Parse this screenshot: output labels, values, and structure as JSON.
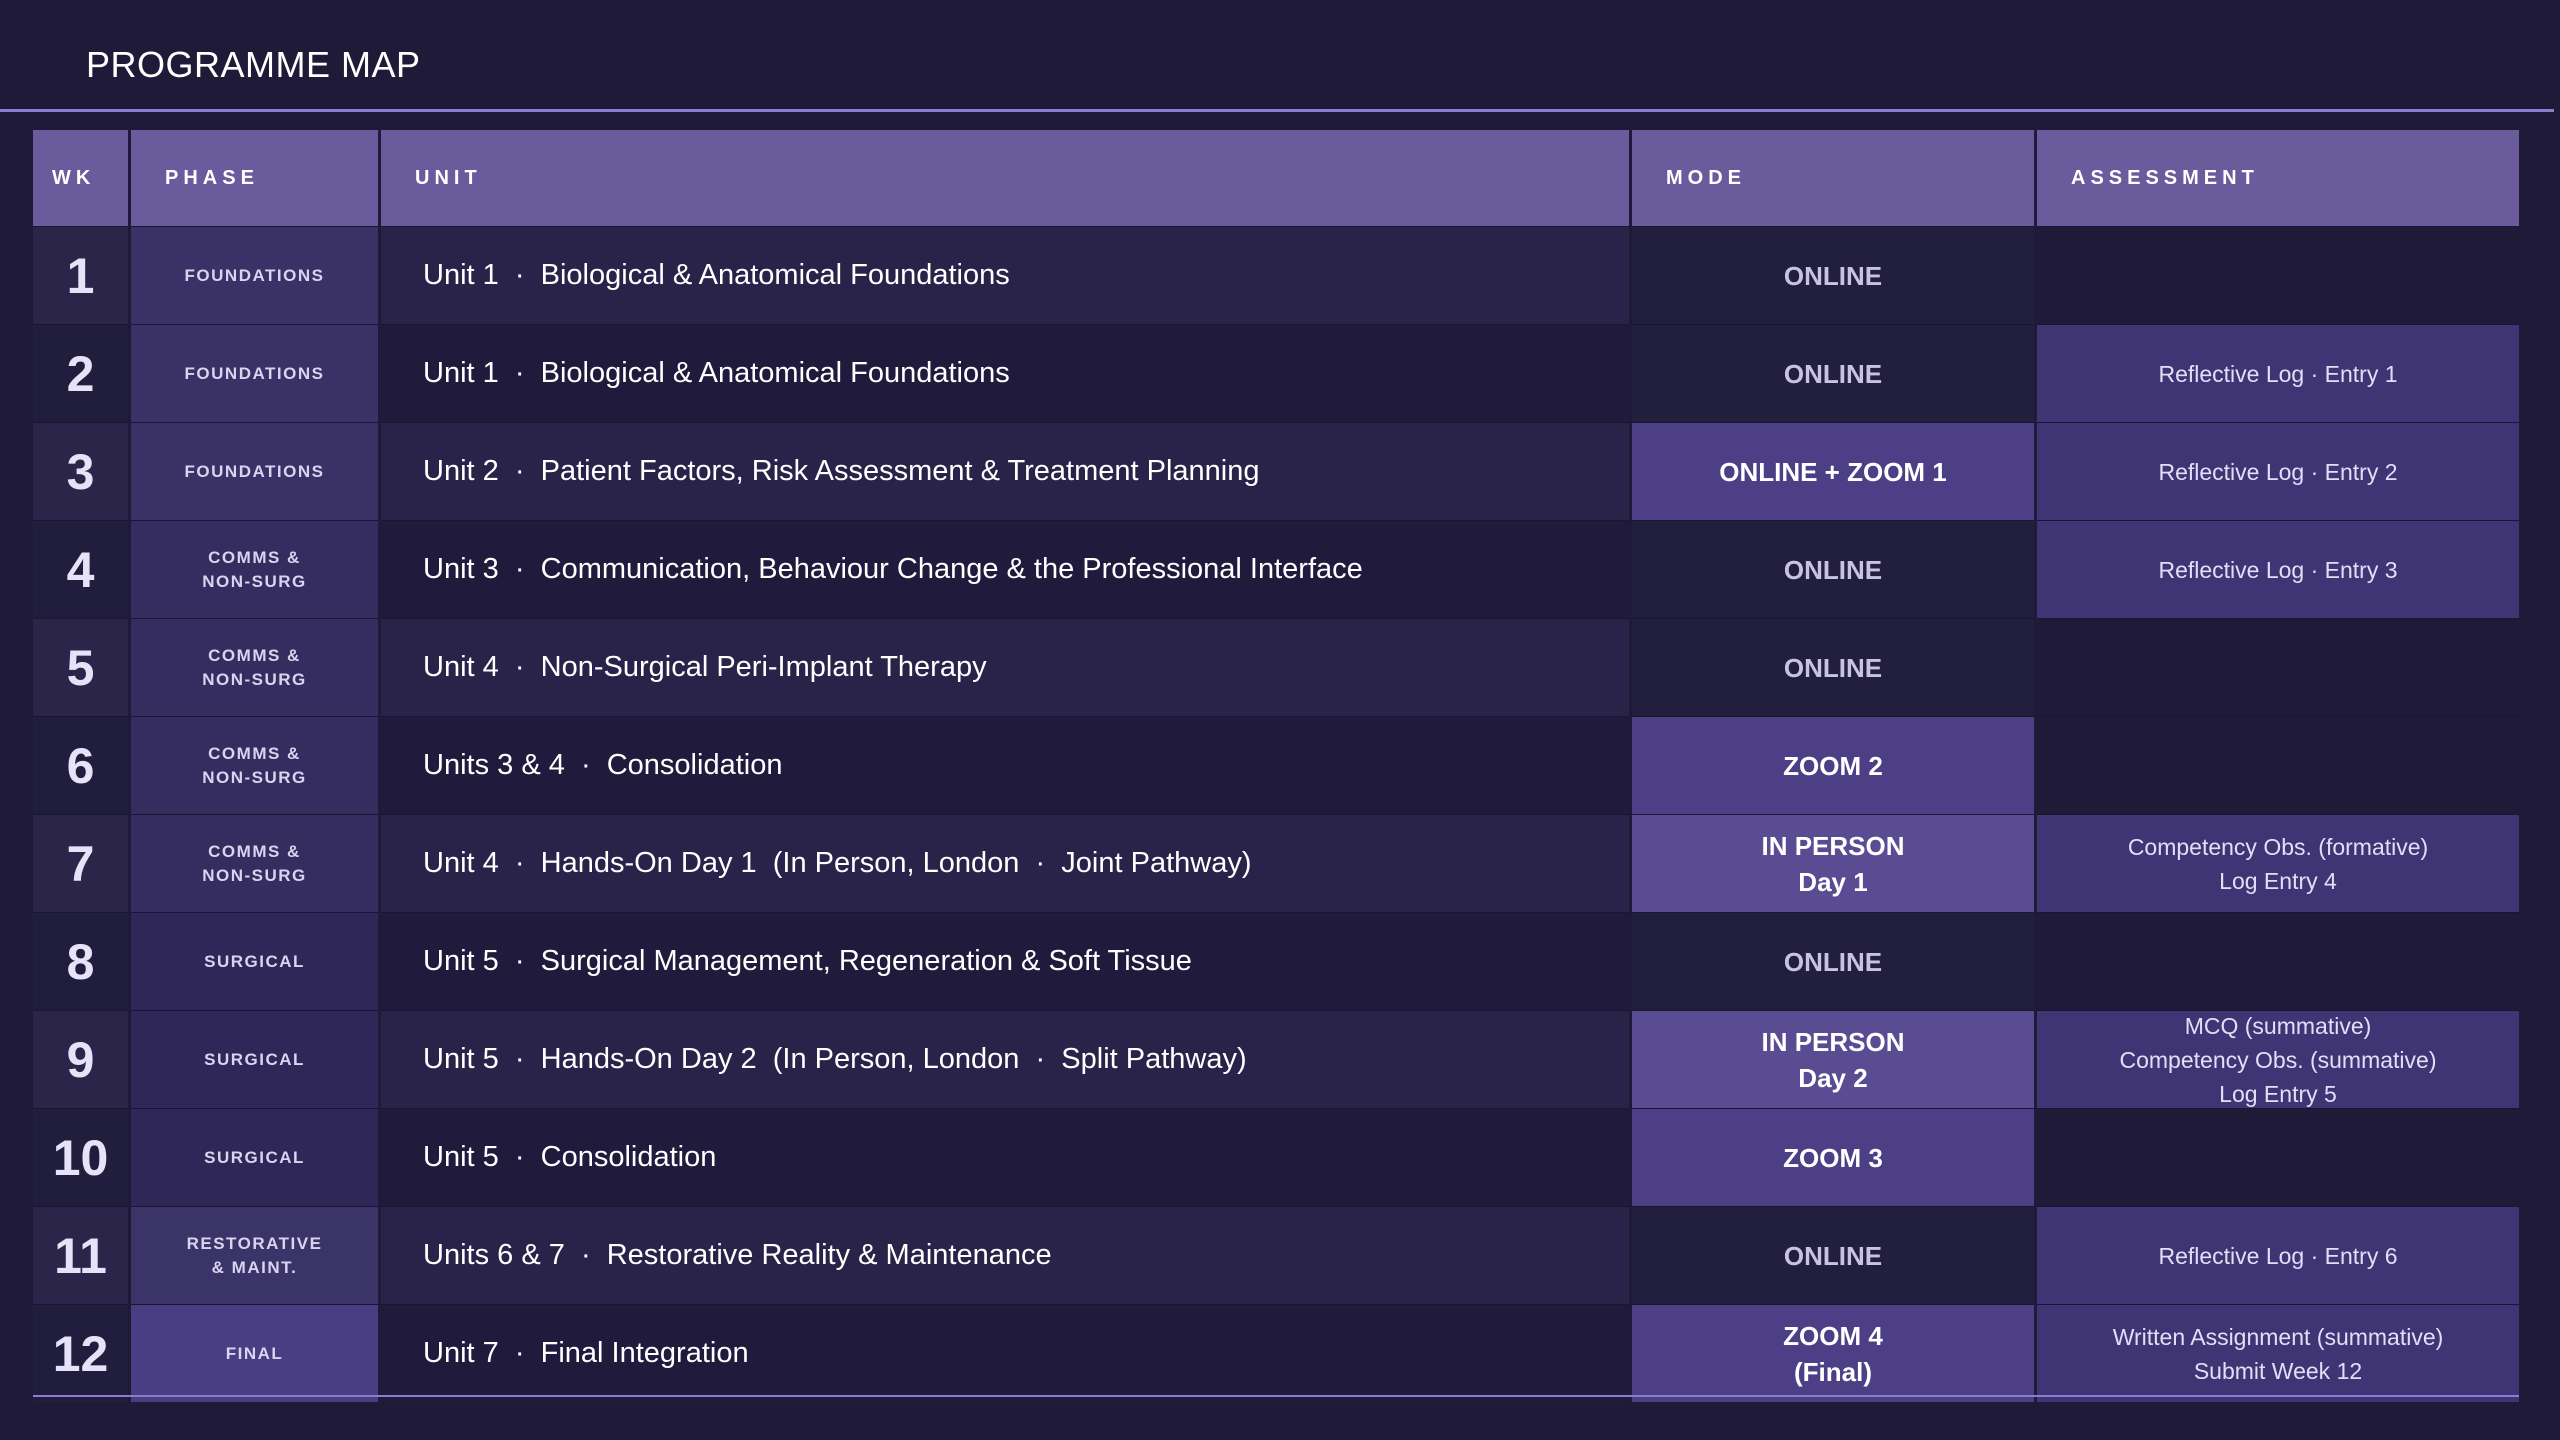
{
  "page": {
    "title": "PROGRAMME MAP"
  },
  "table": {
    "headers": {
      "wk": "WK",
      "phase": "PHASE",
      "unit": "UNIT",
      "mode": "MODE",
      "assessment": "ASSESSMENT"
    },
    "rows": [
      {
        "wk": "1",
        "phase": "FOUNDATIONS",
        "unit": "Unit 1  ·  Biological & Anatomical Foundations",
        "mode": "ONLINE",
        "assessment": ""
      },
      {
        "wk": "2",
        "phase": "FOUNDATIONS",
        "unit": "Unit 1  ·  Biological & Anatomical Foundations",
        "mode": "ONLINE",
        "assessment": "Reflective Log  ·  Entry 1"
      },
      {
        "wk": "3",
        "phase": "FOUNDATIONS",
        "unit": "Unit 2  ·  Patient Factors, Risk Assessment & Treatment Planning",
        "mode": "ONLINE + ZOOM 1",
        "assessment": "Reflective Log  ·  Entry 2"
      },
      {
        "wk": "4",
        "phase": "COMMS &\nNON-SURG",
        "unit": "Unit 3  ·  Communication, Behaviour Change & the Professional Interface",
        "mode": "ONLINE",
        "assessment": "Reflective Log  ·  Entry 3"
      },
      {
        "wk": "5",
        "phase": "COMMS &\nNON-SURG",
        "unit": "Unit 4  ·  Non-Surgical Peri-Implant Therapy",
        "mode": "ONLINE",
        "assessment": ""
      },
      {
        "wk": "6",
        "phase": "COMMS &\nNON-SURG",
        "unit": "Units 3 & 4  ·  Consolidation",
        "mode": "ZOOM 2",
        "assessment": ""
      },
      {
        "wk": "7",
        "phase": "COMMS &\nNON-SURG",
        "unit": "Unit 4  ·  Hands-On Day 1  (In Person, London  ·  Joint Pathway)",
        "mode": "IN PERSON\nDay 1",
        "assessment": "Competency Obs. (formative)\nLog Entry 4"
      },
      {
        "wk": "8",
        "phase": "SURGICAL",
        "unit": "Unit 5  ·  Surgical Management, Regeneration & Soft Tissue",
        "mode": "ONLINE",
        "assessment": ""
      },
      {
        "wk": "9",
        "phase": "SURGICAL",
        "unit": "Unit 5  ·  Hands-On Day 2  (In Person, London  ·  Split Pathway)",
        "mode": "IN PERSON\nDay 2",
        "assessment": "MCQ (summative)\nCompetency Obs. (summative)\nLog Entry 5"
      },
      {
        "wk": "10",
        "phase": "SURGICAL",
        "unit": "Unit 5  ·  Consolidation",
        "mode": "ZOOM 3",
        "assessment": ""
      },
      {
        "wk": "11",
        "phase": "RESTORATIVE\n& MAINT.",
        "unit": "Units 6 & 7  ·  Restorative Reality & Maintenance",
        "mode": "ONLINE",
        "assessment": "Reflective Log  ·  Entry 6"
      },
      {
        "wk": "12",
        "phase": "FINAL",
        "unit": "Unit 7  ·  Final Integration",
        "mode": "ZOOM 4\n(Final)",
        "assessment": "Written Assignment (summative)\nSubmit Week 12"
      }
    ]
  },
  "colors": {
    "background": "#1e1a38",
    "header": "#6a5b9c",
    "accent_line": "#8a7cd0",
    "zoom_mode": "#4c3f86",
    "in_person_mode": "#5a4c92",
    "assessment_fill": "#3f3575"
  }
}
